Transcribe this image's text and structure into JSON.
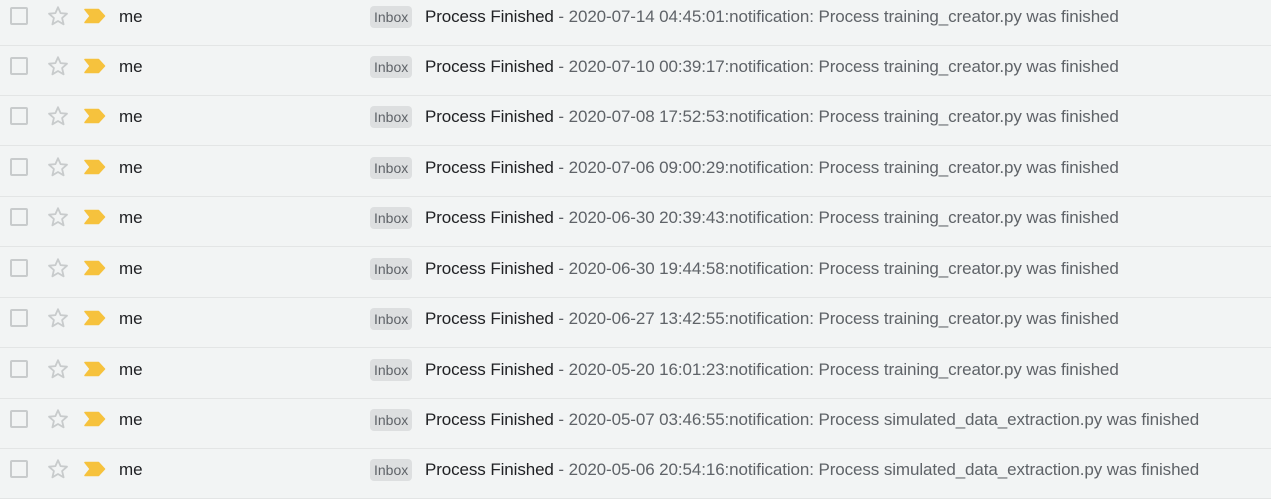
{
  "colors": {
    "row_background": "#f2f4f4",
    "important_marker": "#f6c23d",
    "label_background": "#dddfe0",
    "subject_text": "#202124",
    "snippet_text": "#5f6368"
  },
  "icons": {
    "checkbox": "checkbox-icon",
    "star": "star-outline-icon",
    "important": "important-marker-icon"
  },
  "emails": [
    {
      "sender": "me",
      "label": "Inbox",
      "subject": "Process Finished",
      "snippet": " - 2020-07-14 04:45:01:notification: Process training_creator.py was finished"
    },
    {
      "sender": "me",
      "label": "Inbox",
      "subject": "Process Finished",
      "snippet": " - 2020-07-10 00:39:17:notification: Process training_creator.py was finished"
    },
    {
      "sender": "me",
      "label": "Inbox",
      "subject": "Process Finished",
      "snippet": " - 2020-07-08 17:52:53:notification: Process training_creator.py was finished"
    },
    {
      "sender": "me",
      "label": "Inbox",
      "subject": "Process Finished",
      "snippet": " - 2020-07-06 09:00:29:notification: Process training_creator.py was finished"
    },
    {
      "sender": "me",
      "label": "Inbox",
      "subject": "Process Finished",
      "snippet": " - 2020-06-30 20:39:43:notification: Process training_creator.py was finished"
    },
    {
      "sender": "me",
      "label": "Inbox",
      "subject": "Process Finished",
      "snippet": " - 2020-06-30 19:44:58:notification: Process training_creator.py was finished"
    },
    {
      "sender": "me",
      "label": "Inbox",
      "subject": "Process Finished",
      "snippet": " - 2020-06-27 13:42:55:notification: Process training_creator.py was finished"
    },
    {
      "sender": "me",
      "label": "Inbox",
      "subject": "Process Finished",
      "snippet": " - 2020-05-20 16:01:23:notification: Process training_creator.py was finished"
    },
    {
      "sender": "me",
      "label": "Inbox",
      "subject": "Process Finished",
      "snippet": " - 2020-05-07 03:46:55:notification: Process simulated_data_extraction.py was finished"
    },
    {
      "sender": "me",
      "label": "Inbox",
      "subject": "Process Finished",
      "snippet": " - 2020-05-06 20:54:16:notification: Process simulated_data_extraction.py was finished"
    }
  ]
}
